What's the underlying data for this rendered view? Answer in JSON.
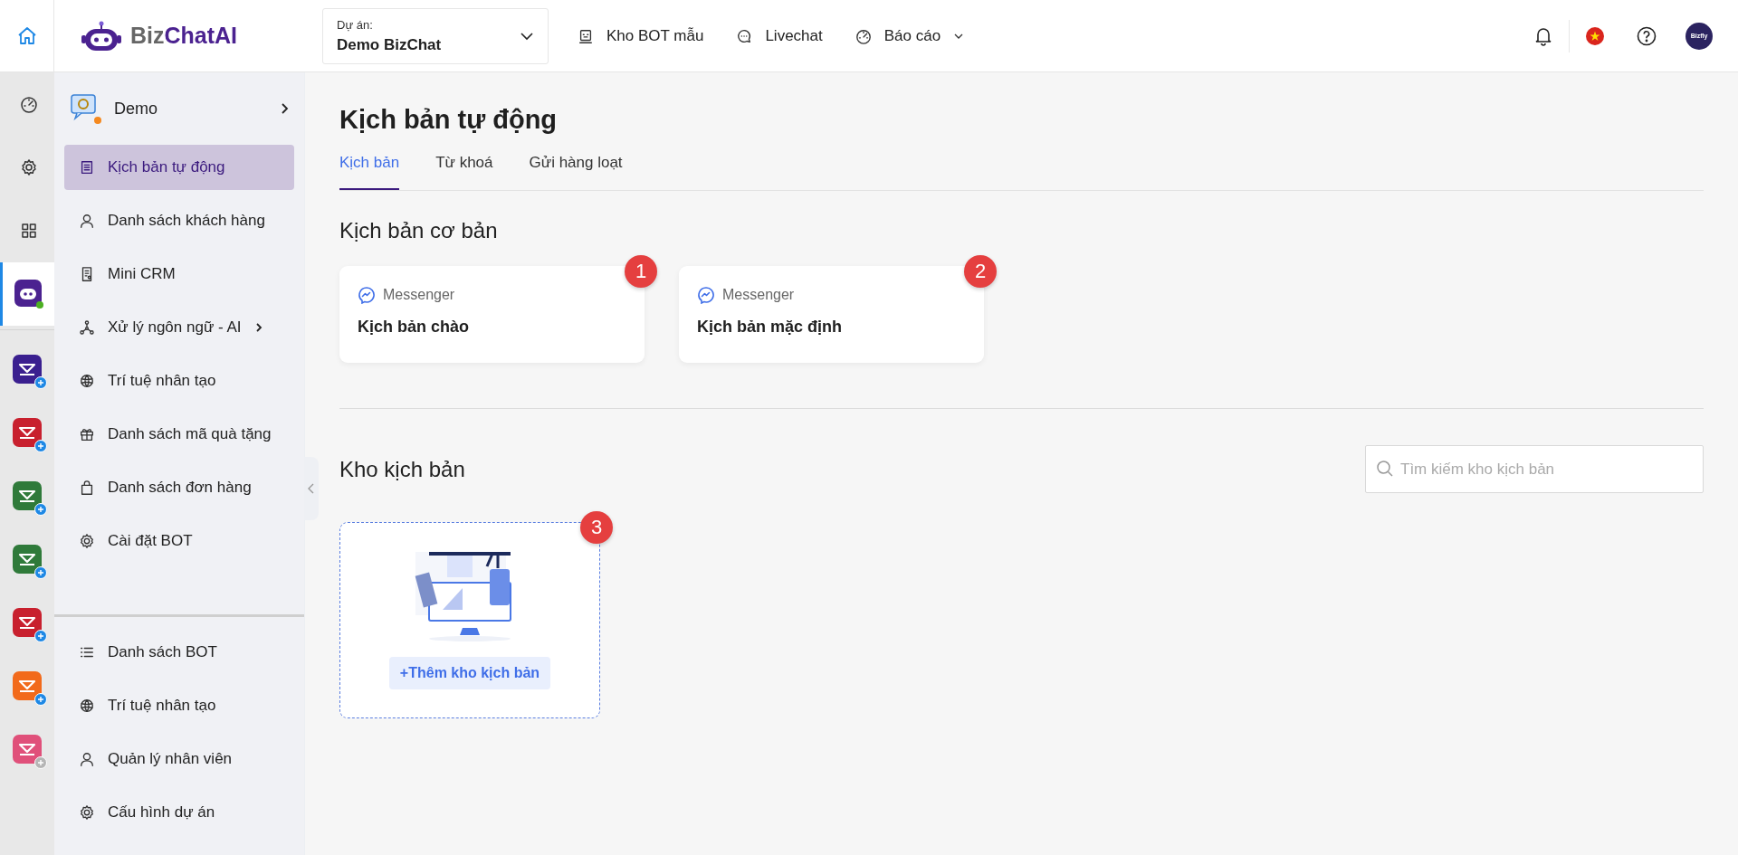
{
  "topbar": {
    "logo": "Biz**ChatAI**",
    "project": {
      "label": "Dự án:",
      "value": "Demo BizChat"
    },
    "nav": [
      {
        "label": "Kho BOT mẫu",
        "has_menu": false
      },
      {
        "label": "Livechat",
        "has_menu": false
      },
      {
        "label": "Báo cáo",
        "has_menu": true
      }
    ],
    "avatar": "Bizfly"
  },
  "rail": {
    "tools": [
      {
        "selected": false
      },
      {
        "selected": false
      },
      {
        "selected": false
      },
      {
        "selected": true
      }
    ],
    "apps": [
      {
        "color": "#3a1f8f",
        "disabled": false
      },
      {
        "color": "#c8202e",
        "disabled": false
      },
      {
        "color": "#2f7a3a",
        "disabled": false
      },
      {
        "color": "#2f7a3a",
        "disabled": false
      },
      {
        "color": "#c8202e",
        "disabled": false
      },
      {
        "color": "#f26a1b",
        "disabled": false
      },
      {
        "color": "#e0507a",
        "disabled": true
      }
    ]
  },
  "sidebar": {
    "header": "Demo",
    "items": [
      {
        "label": "Kịch bản tự động",
        "selected": true,
        "has_submenu": false
      },
      {
        "label": "Danh sách khách hàng",
        "selected": false,
        "has_submenu": false
      },
      {
        "label": "Mini CRM",
        "selected": false,
        "has_submenu": false
      },
      {
        "label": "Xử lý ngôn ngữ - AI",
        "selected": false,
        "has_submenu": true
      },
      {
        "label": "Trí tuệ nhân tạo",
        "selected": false,
        "has_submenu": false
      },
      {
        "label": "Danh sách mã quà tặng",
        "selected": false,
        "has_submenu": false
      },
      {
        "label": "Danh sách đơn hàng",
        "selected": false,
        "has_submenu": false
      },
      {
        "label": "Cài đặt BOT",
        "selected": false,
        "has_submenu": false
      }
    ],
    "bottom_items": [
      {
        "label": "Danh sách BOT",
        "selected": false
      },
      {
        "label": "Trí tuệ nhân tạo",
        "selected": false
      },
      {
        "label": "Quản lý nhân viên",
        "selected": false
      },
      {
        "label": "Cấu hình dự án",
        "selected": false
      }
    ]
  },
  "page": {
    "title": "Kịch bản tự động",
    "tabs": [
      {
        "label": "Kịch bản",
        "selected": true
      },
      {
        "label": "Từ khoá",
        "selected": false
      },
      {
        "label": "Gửi hàng loạt",
        "selected": false
      }
    ],
    "basic": {
      "heading": "Kịch bản cơ bản",
      "cards": [
        {
          "channel": "Messenger",
          "title": "Kịch bản chào",
          "badge": "1"
        },
        {
          "channel": "Messenger",
          "title": "Kịch bản mặc định",
          "badge": "2"
        }
      ]
    },
    "store": {
      "heading": "Kho kịch bản",
      "search": {
        "placeholder": "Tìm kiếm kho kịch bản"
      },
      "add_button": "+Thêm kho kịch bản",
      "badge": "3"
    }
  }
}
